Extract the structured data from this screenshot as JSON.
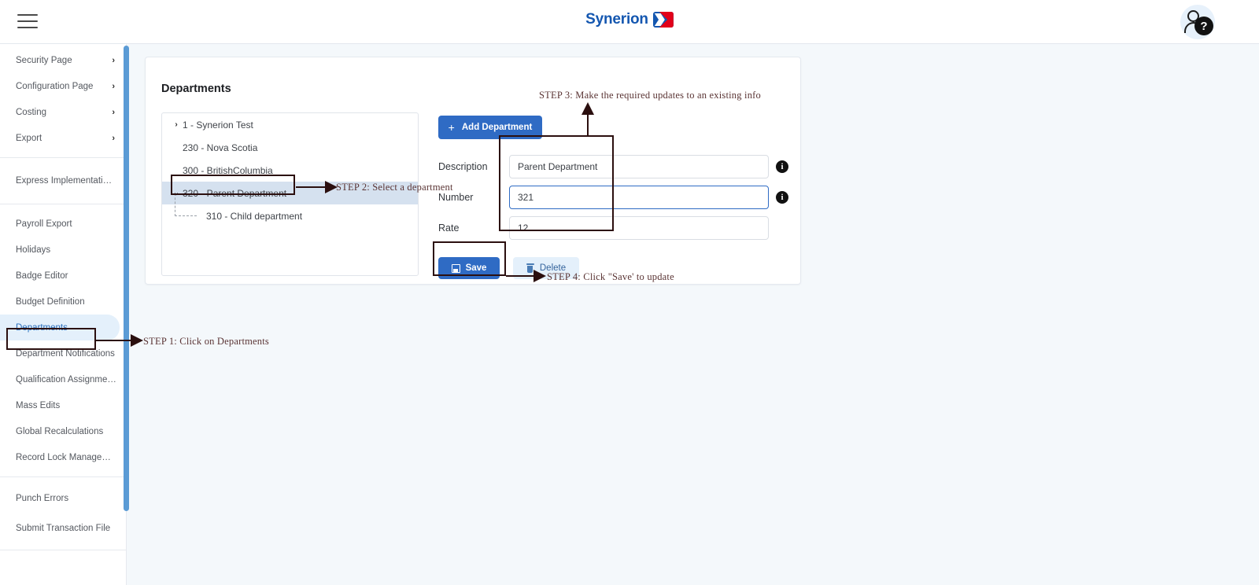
{
  "topbar": {
    "menu_icon": "hamburger-menu-icon",
    "brand_text": "Synerion",
    "brand_mark_colors": {
      "blue": "#1457b0",
      "red": "#e2001a"
    },
    "help_badge": "?",
    "help_icon": "user-help-avatar-icon"
  },
  "sidebar": {
    "groups": [
      {
        "items": [
          {
            "label": "Security Page",
            "expandable": true
          },
          {
            "label": "Configuration Page",
            "expandable": true
          },
          {
            "label": "Costing",
            "expandable": true
          },
          {
            "label": "Export",
            "expandable": true
          }
        ]
      },
      {
        "items": [
          {
            "label": "Express Implementation P...",
            "expandable": false
          }
        ]
      },
      {
        "items": [
          {
            "label": "Payroll Export",
            "expandable": false
          },
          {
            "label": "Holidays",
            "expandable": false
          },
          {
            "label": "Badge Editor",
            "expandable": false
          },
          {
            "label": "Budget Definition",
            "expandable": false
          },
          {
            "label": "Departments",
            "expandable": false,
            "active": true
          },
          {
            "label": "Department Notifications",
            "expandable": false
          },
          {
            "label": "Qualification Assignments",
            "expandable": false
          },
          {
            "label": "Mass Edits",
            "expandable": false
          },
          {
            "label": "Global Recalculations",
            "expandable": false
          },
          {
            "label": "Record Lock Management",
            "expandable": false
          }
        ]
      },
      {
        "items": [
          {
            "label": "Punch Errors",
            "expandable": false
          },
          {
            "label": "Submit Transaction File",
            "expandable": false
          }
        ]
      }
    ],
    "chevron_glyph": "›",
    "scrollbar_color": "#5b9bd5"
  },
  "card": {
    "title": "Departments",
    "tree": {
      "nodes": [
        {
          "label": "1 - Synerion Test",
          "twisty": "›",
          "level": 0,
          "selected": false
        },
        {
          "label": "230 - Nova Scotia",
          "twisty": "",
          "level": 0,
          "selected": false
        },
        {
          "label": "300 - BritishColumbia",
          "twisty": "",
          "level": 0,
          "selected": false
        },
        {
          "label": "320 - Parent Department",
          "twisty": "⌄",
          "level": 0,
          "selected": true
        },
        {
          "label": "310 - Child department",
          "twisty": "",
          "level": 1,
          "selected": false
        }
      ]
    },
    "add_button": {
      "label": "Add Department",
      "plus": "+"
    },
    "fields": [
      {
        "label": "Description",
        "value": "Parent Department",
        "focused": false,
        "info": true
      },
      {
        "label": "Number",
        "value": "321",
        "focused": true,
        "info": true
      },
      {
        "label": "Rate",
        "value": "12",
        "focused": false,
        "info": false
      }
    ],
    "save_button": {
      "label": "Save",
      "icon": "floppy-disk-icon"
    },
    "delete_button": {
      "label": "Delete",
      "icon": "trash-icon"
    }
  },
  "annotations": {
    "step1": "STEP 1: Click on Departments",
    "step2": "STEP 2: Select a department",
    "step3": "STEP 3: Make the required updates to an existing info",
    "step4": "STEP 4: Click \"Save' to update",
    "outline_color": "#2b0f0f",
    "text_color": "#5a3434"
  }
}
